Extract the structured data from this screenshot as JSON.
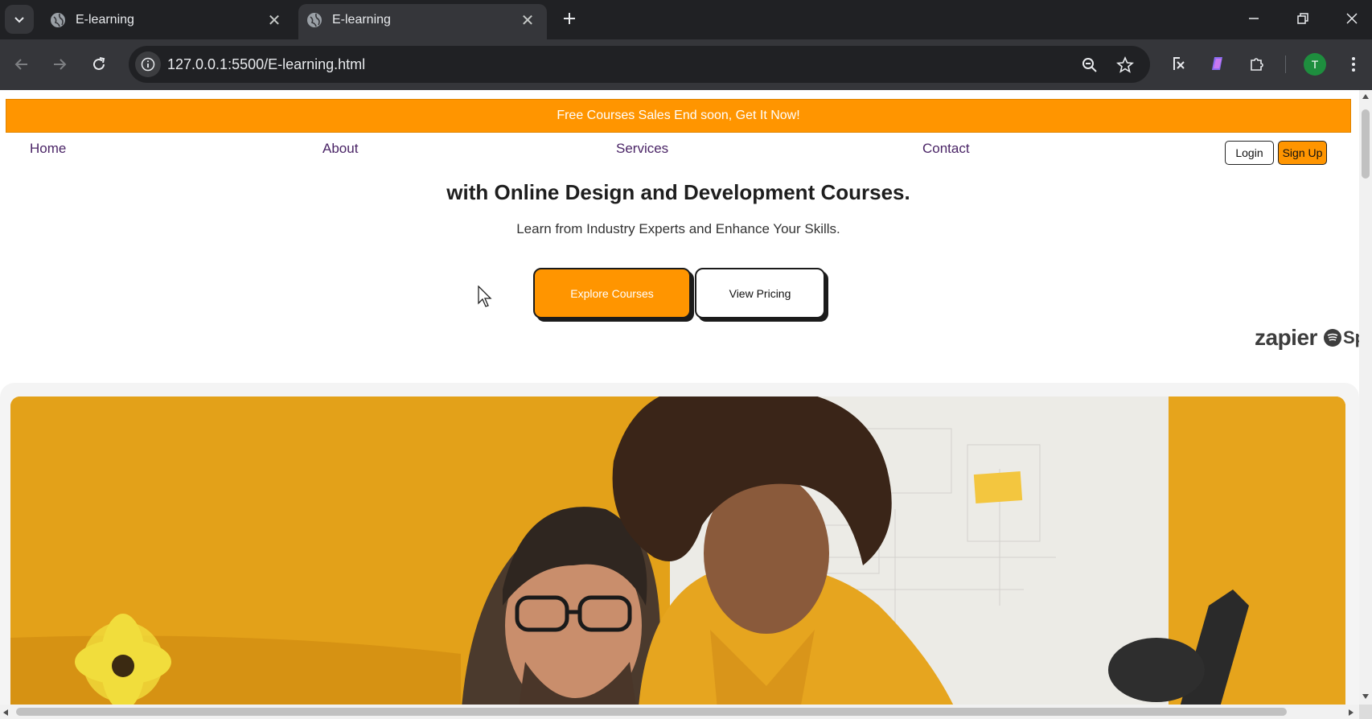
{
  "browser": {
    "tabs": [
      {
        "title": "E-learning",
        "active": false
      },
      {
        "title": "E-learning",
        "active": true
      }
    ],
    "url": "127.0.0.1:5500/E-learning.html",
    "profile_initial": "T",
    "icons": [
      "tab-search-icon",
      "globe-icon",
      "close-icon",
      "plus-icon",
      "minimize-icon",
      "restore-icon",
      "back-icon",
      "forward-icon",
      "reload-icon",
      "info-icon",
      "zoom-icon",
      "star-icon",
      "extension-icon",
      "puzzle-icon",
      "more-icon"
    ]
  },
  "page": {
    "banner": "Free Courses Sales End soon, Get It Now!",
    "nav": {
      "home": "Home",
      "about": "About",
      "services": "Services",
      "contact": "Contact",
      "login": "Login",
      "signup": "Sign Up"
    },
    "hero": {
      "title": "with Online Design and Development Courses.",
      "subtitle": "Learn from Industry Experts and Enhance Your Skills.",
      "explore_label": "Explore Courses",
      "pricing_label": "View Pricing"
    },
    "brands": {
      "zapier": "zapier",
      "spotify_partial": "Spot"
    }
  },
  "colors": {
    "accent": "#ff9500",
    "nav_link": "#4a2466",
    "chrome_dark": "#202124",
    "chrome_toolbar": "#35363a"
  }
}
